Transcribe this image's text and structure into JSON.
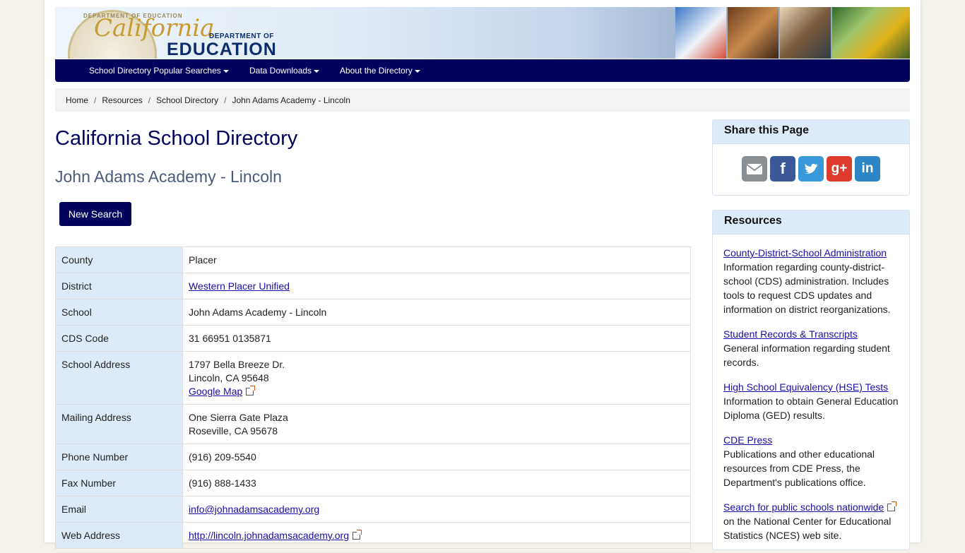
{
  "banner": {
    "seal_text": "DEPARTMENT OF EDUCATION",
    "logo_california": "California",
    "logo_dept": "DEPARTMENT OF",
    "logo_education": "EDUCATION"
  },
  "nav": {
    "items": [
      {
        "label": "School Directory Popular Searches"
      },
      {
        "label": "Data Downloads"
      },
      {
        "label": "About the Directory"
      }
    ]
  },
  "breadcrumb": {
    "items": [
      "Home",
      "Resources",
      "School Directory",
      "John Adams Academy - Lincoln"
    ],
    "separator": "/"
  },
  "main": {
    "title": "California School Directory",
    "subtitle": "John Adams Academy - Lincoln",
    "new_search_label": "New Search"
  },
  "details": {
    "county_label": "County",
    "county": "Placer",
    "district_label": "District",
    "district": "Western Placer Unified",
    "school_label": "School",
    "school": "John Adams Academy - Lincoln",
    "cds_label": "CDS Code",
    "cds": "31 66951 0135871",
    "school_address_label": "School Address",
    "school_address_1": "1797 Bella Breeze Dr.",
    "school_address_2": "Lincoln, CA 95648",
    "google_map": "Google Map",
    "mailing_address_label": "Mailing Address",
    "mailing_address_1": "One Sierra Gate Plaza",
    "mailing_address_2": "Roseville, CA 95678",
    "phone_label": "Phone Number",
    "phone": "(916) 209-5540",
    "fax_label": "Fax Number",
    "fax": "(916) 888-1433",
    "email_label": "Email",
    "email": "info@johnadamsacademy.org",
    "web_label": "Web Address",
    "web": "http://lincoln.johnadamsacademy.org"
  },
  "share": {
    "title": "Share this Page",
    "icons": [
      "email-icon",
      "facebook-icon",
      "twitter-icon",
      "google-plus-icon",
      "linkedin-icon"
    ],
    "colors": {
      "email": "#8a8f94",
      "facebook": "#3b5998",
      "twitter": "#3a9ad9",
      "google": "#dd3b2c",
      "linkedin": "#2e86c6"
    }
  },
  "resources": {
    "title": "Resources",
    "items": [
      {
        "link": "County-District-School Administration",
        "desc": "Information regarding county-district-school (CDS) administration. Includes tools to request CDS updates and information on district reorganizations."
      },
      {
        "link": "Student Records & Transcripts",
        "desc": "General information regarding student records."
      },
      {
        "link": "High School Equivalency (HSE) Tests",
        "desc": "Information to obtain General Education Diploma (GED) results."
      },
      {
        "link": "CDE Press",
        "desc": "Publications and other educational resources from CDE Press, the Department's publications office."
      },
      {
        "link": "Search for public schools nationwide",
        "desc": "on the National Center for Educational Statistics (NCES) web site."
      }
    ]
  },
  "colors": {
    "nav": "#03035e",
    "label_cell": "#ddebf8",
    "link": "#1a0dab"
  }
}
